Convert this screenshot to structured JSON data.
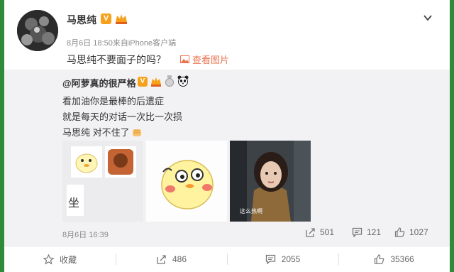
{
  "post": {
    "user_name": "马思纯",
    "badge_v": "V",
    "meta": "8月6日 18:50来自iPhone客户端",
    "text": "马思纯不要面子的吗？",
    "view_pic_label": "查看图片"
  },
  "repost": {
    "user": "@阿萝真的很严格",
    "badge_v": "V",
    "lines": [
      "看加油你是最棒的后遗症",
      "就是每天的对话一次比一次损",
      "马思纯 对不住了"
    ],
    "thumb1_text": "坐",
    "thumb3_caption": "这么热啊",
    "time": "8月6日 16:39",
    "stats": {
      "reposts": "501",
      "comments": "121",
      "likes": "1027"
    }
  },
  "footer": {
    "favorite": "收藏",
    "repost": "486",
    "comment": "2055",
    "like": "35366"
  },
  "colors": {
    "accent_orange": "#eb7350",
    "badge": "#f7a11a",
    "repost_bg": "#f2f2f5"
  }
}
